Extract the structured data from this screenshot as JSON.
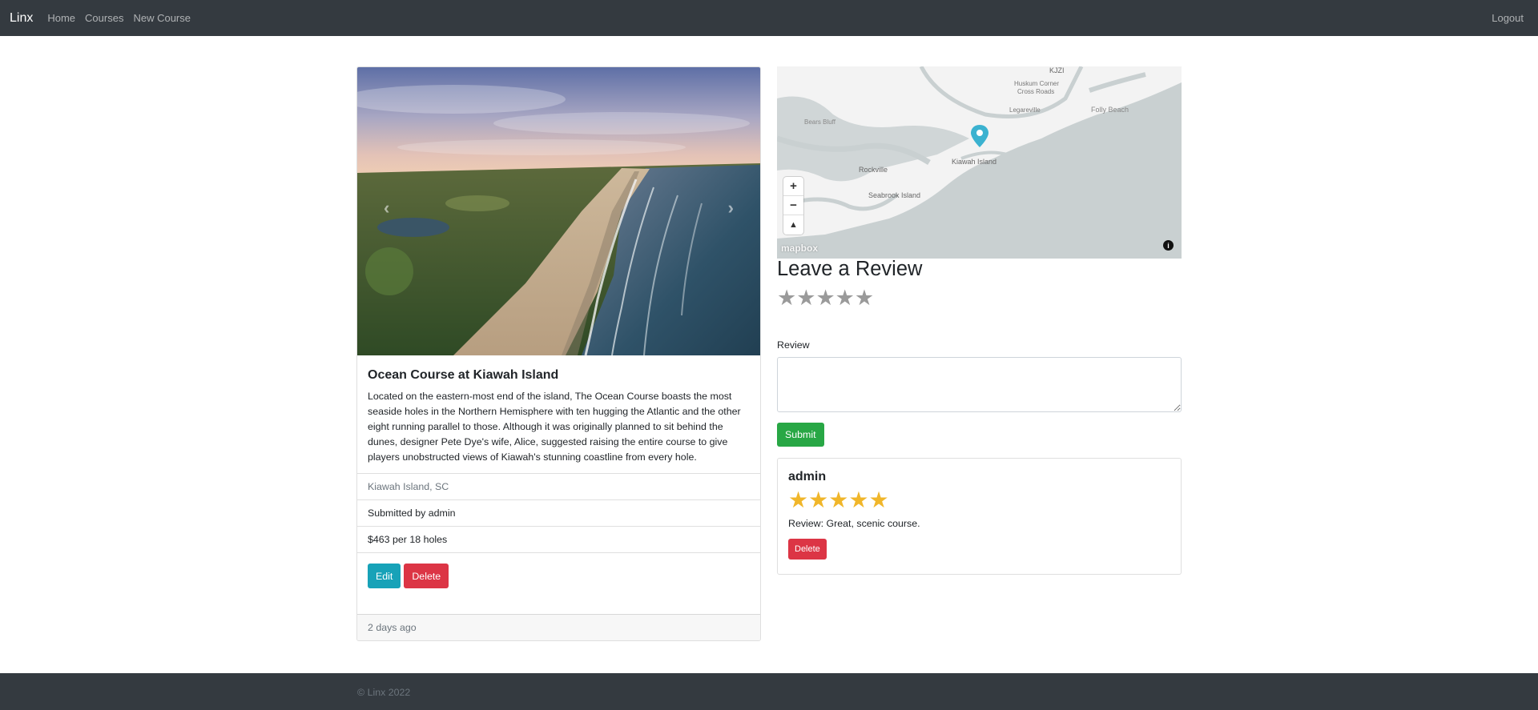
{
  "navbar": {
    "brand": "Linx",
    "links": [
      "Home",
      "Courses",
      "New Course"
    ],
    "logout": "Logout"
  },
  "course": {
    "title": "Ocean Course at Kiawah Island",
    "description": "Located on the eastern-most end of the island, The Ocean Course boasts the most seaside holes in the Northern Hemisphere with ten hugging the Atlantic and the other eight running parallel to those. Although it was originally planned to sit behind the dunes, designer Pete Dye's wife, Alice, suggested raising the entire course to give players unobstructed views of Kiawah's stunning coastline from every hole.",
    "location": "Kiawah Island, SC",
    "submitted_by": "Submitted by admin",
    "price": "$463 per 18 holes",
    "edit_label": "Edit",
    "delete_label": "Delete",
    "posted": "2 days ago"
  },
  "map": {
    "labels": [
      "KJZI",
      "Huskum Corner",
      "Cross Roads",
      "Legareville",
      "Folly Beach",
      "Rockville",
      "Kiawah Island",
      "Seabrook Island",
      "Bears Bluff"
    ],
    "zoom_in": "+",
    "zoom_out": "−",
    "compass": "▲",
    "attribution": "mapbox",
    "info": "i"
  },
  "review_form": {
    "heading": "Leave a Review",
    "rating": 0,
    "label": "Review",
    "submit_label": "Submit"
  },
  "reviews": [
    {
      "author": "admin",
      "rating": 5,
      "text": "Review: Great, scenic course.",
      "delete_label": "Delete"
    }
  ],
  "footer": {
    "text": "© Linx 2022"
  },
  "colors": {
    "navbar": "#343a40",
    "info": "#17a2b8",
    "danger": "#dc3545",
    "success": "#28a745",
    "star_filled": "#f0b62a",
    "star_empty": "#9a9a9a",
    "map_marker": "#3bb2d0"
  }
}
